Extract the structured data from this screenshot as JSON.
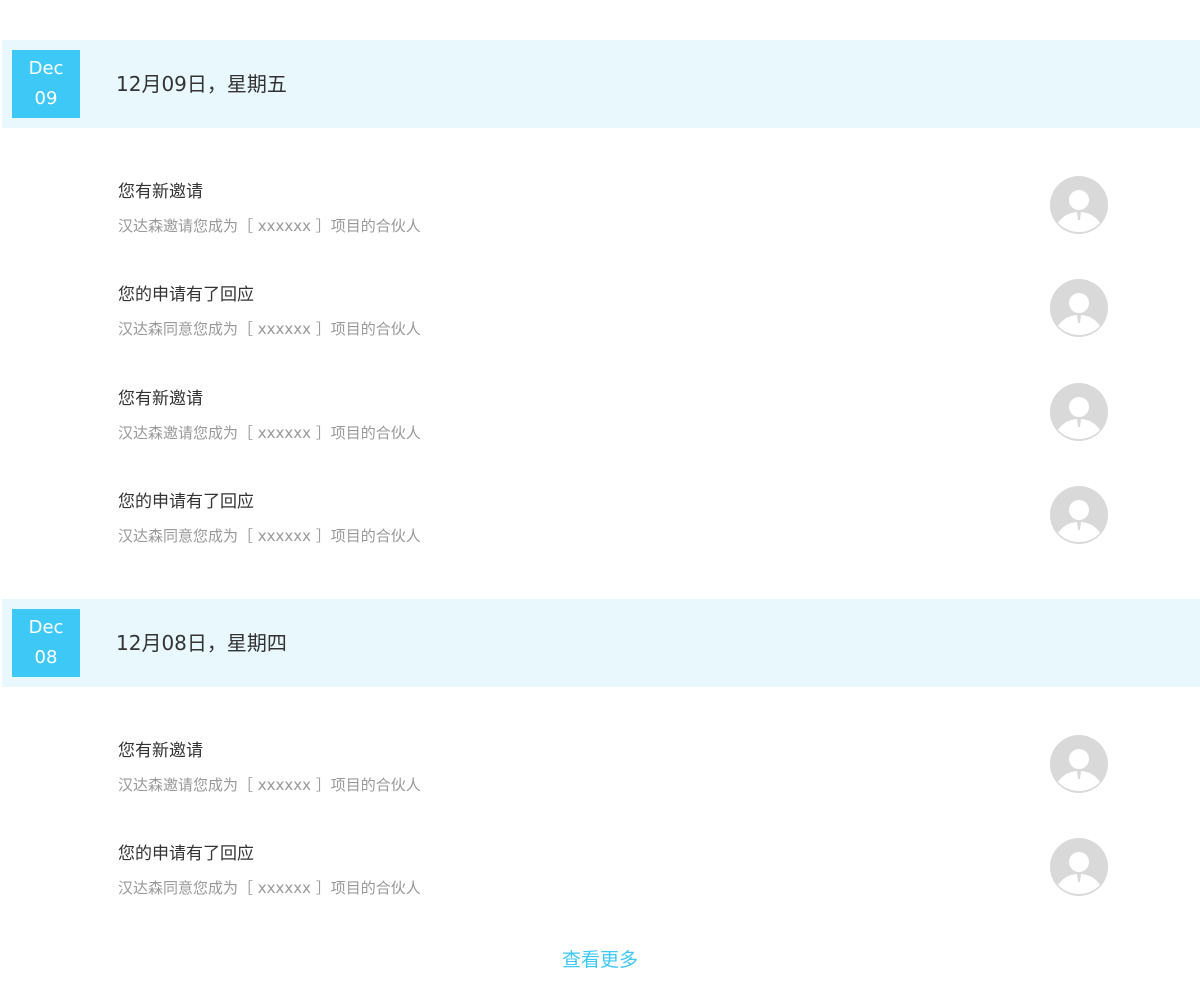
{
  "groups": [
    {
      "month": "Dec",
      "day": "09",
      "title": "12月09日，星期五",
      "items": [
        {
          "title": "您有新邀请",
          "desc": "汉达森邀请您成为［ xxxxxx ］项目的合伙人",
          "avatar_icon": "user-avatar-icon"
        },
        {
          "title": "您的申请有了回应",
          "desc": "汉达森同意您成为［ xxxxxx ］项目的合伙人",
          "avatar_icon": "user-avatar-icon"
        },
        {
          "title": "您有新邀请",
          "desc": "汉达森邀请您成为［ xxxxxx ］项目的合伙人",
          "avatar_icon": "user-avatar-icon"
        },
        {
          "title": "您的申请有了回应",
          "desc": "汉达森同意您成为［ xxxxxx ］项目的合伙人",
          "avatar_icon": "user-avatar-icon"
        }
      ]
    },
    {
      "month": "Dec",
      "day": "08",
      "title": "12月08日，星期四",
      "items": [
        {
          "title": "您有新邀请",
          "desc": "汉达森邀请您成为［ xxxxxx ］项目的合伙人",
          "avatar_icon": "user-avatar-icon"
        },
        {
          "title": "您的申请有了回应",
          "desc": "汉达森同意您成为［ xxxxxx ］项目的合伙人",
          "avatar_icon": "user-avatar-icon"
        }
      ]
    }
  ],
  "more_label": "查看更多",
  "colors": {
    "accent": "#3ec8f5",
    "header_bg": "#e8f8fd",
    "title_text": "#333333",
    "desc_text": "#999999",
    "avatar_gray": "#d9d9d9"
  }
}
